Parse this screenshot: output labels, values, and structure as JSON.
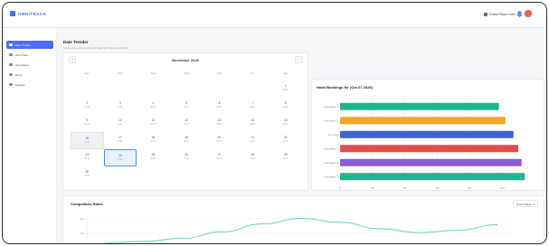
{
  "app": {
    "logo_text": "OMNITRACK"
  },
  "header": {
    "hotel_label": "Grand Plaza Hotel"
  },
  "sidebar": {
    "items": [
      {
        "label": "Date Trender",
        "active": true
      },
      {
        "label": "Hotel Data",
        "active": false
      },
      {
        "label": "Hotel Rates",
        "active": false
      },
      {
        "label": "Alerts",
        "active": false
      },
      {
        "label": "Settings",
        "active": false
      }
    ]
  },
  "page": {
    "title": "Date Trender",
    "subtitle": "Track and analyze rates for selected dates and hotels"
  },
  "calendar": {
    "prev_icon": "chevron-left-icon",
    "next_icon": "chevron-right-icon",
    "month_label": "November 2025",
    "weekdays": [
      "Sun",
      "Mon",
      "Tue",
      "Wed",
      "Thu",
      "Fri",
      "Sat"
    ],
    "days": [
      {
        "d": "",
        "s": ""
      },
      {
        "d": "",
        "s": ""
      },
      {
        "d": "",
        "s": ""
      },
      {
        "d": "",
        "s": ""
      },
      {
        "d": "",
        "s": ""
      },
      {
        "d": "",
        "s": ""
      },
      {
        "d": "1",
        "s": "$152"
      },
      {
        "d": "2",
        "s": "$149"
      },
      {
        "d": "3",
        "s": "$151"
      },
      {
        "d": "4",
        "s": "$148"
      },
      {
        "d": "5",
        "s": "$150"
      },
      {
        "d": "6",
        "s": "$155"
      },
      {
        "d": "7",
        "s": "$160"
      },
      {
        "d": "8",
        "s": "$162"
      },
      {
        "d": "9",
        "s": "$149"
      },
      {
        "d": "10",
        "s": "$147"
      },
      {
        "d": "11",
        "s": "$150"
      },
      {
        "d": "12",
        "s": "$151"
      },
      {
        "d": "13",
        "s": "$154"
      },
      {
        "d": "14",
        "s": "$159"
      },
      {
        "d": "15",
        "s": "$163"
      },
      {
        "d": "16",
        "s": "$150"
      },
      {
        "d": "17",
        "s": "$148"
      },
      {
        "d": "18",
        "s": "$149"
      },
      {
        "d": "19",
        "s": "$152"
      },
      {
        "d": "20",
        "s": "$155"
      },
      {
        "d": "21",
        "s": "$161"
      },
      {
        "d": "22",
        "s": "$165"
      },
      {
        "d": "23",
        "s": "$151"
      },
      {
        "d": "24",
        "s": "$150"
      },
      {
        "d": "25",
        "s": "$153"
      },
      {
        "d": "26",
        "s": "$156"
      },
      {
        "d": "27",
        "s": "$158"
      },
      {
        "d": "28",
        "s": "$166"
      },
      {
        "d": "29",
        "s": "$170"
      },
      {
        "d": "30",
        "s": "$152"
      }
    ],
    "today_index": 21,
    "selected_index": 29
  },
  "bookings_chart": {
    "title": "Hotel Bookings for (Oct 07 2025)"
  },
  "compset": {
    "title": "Competitors Rates",
    "select_label": "Grand Plaza"
  },
  "chart_data": [
    {
      "type": "bar",
      "orientation": "horizontal",
      "categories": [
        "Competitor 1",
        "Competitor 2",
        "My Hotel",
        "Competitor 3",
        "Competitor 4",
        "Competitor 5"
      ],
      "values": [
        98,
        102,
        107,
        110,
        112,
        114
      ],
      "colors": [
        "#1fb58e",
        "#f5a623",
        "#3f62d8",
        "#e84a4a",
        "#8b5cd6",
        "#1fb58e"
      ],
      "xlim": [
        0,
        120
      ],
      "xticks": [
        "0",
        "20",
        "40",
        "60",
        "80",
        "100"
      ],
      "xlabel": "Rate (US)",
      "title": "Hotel Bookings for (Oct 07 2025)"
    },
    {
      "type": "line",
      "y_ticks": [
        "300",
        "200"
      ],
      "series": [
        {
          "color": "#5ed0c4",
          "values": [
            10,
            14,
            22,
            38,
            58,
            72,
            62,
            46,
            36,
            42,
            56
          ]
        }
      ]
    }
  ]
}
